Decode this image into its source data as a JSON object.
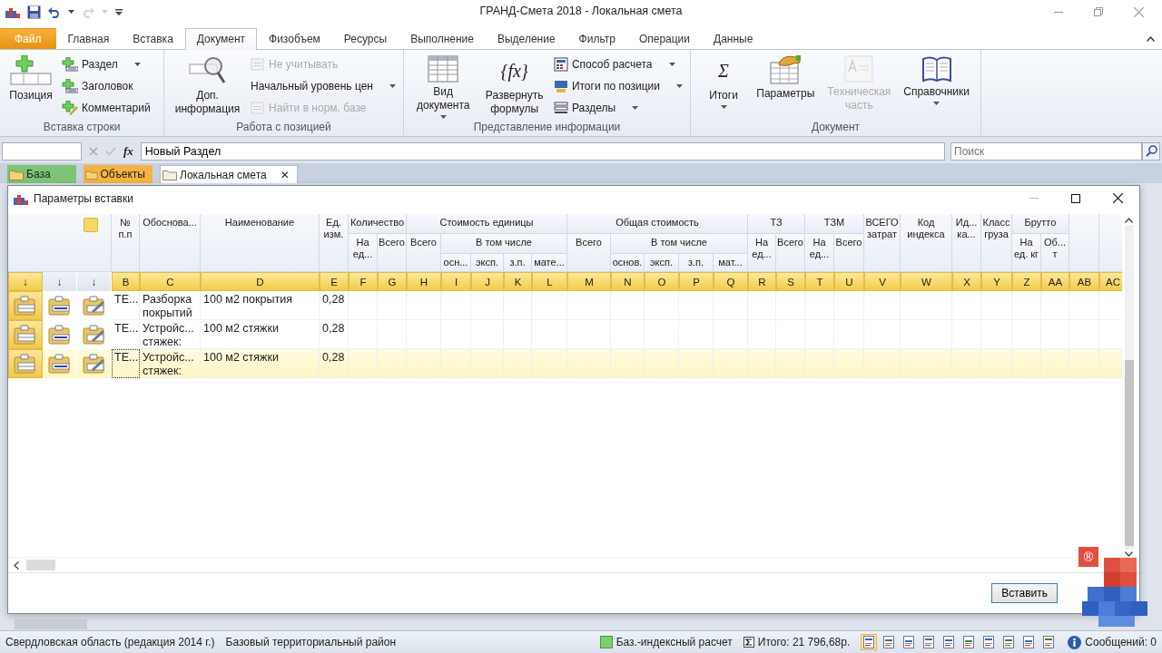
{
  "window": {
    "title": "ГРАНД-Смета 2018 - Локальная смета"
  },
  "ribbon_tabs": [
    {
      "label": "Файл",
      "kind": "file",
      "selected": false
    },
    {
      "label": "Главная",
      "kind": "tab",
      "selected": false
    },
    {
      "label": "Вставка",
      "kind": "tab",
      "selected": false
    },
    {
      "label": "Документ",
      "kind": "tab",
      "selected": true
    },
    {
      "label": "Физобъем",
      "kind": "tab",
      "selected": false
    },
    {
      "label": "Ресурсы",
      "kind": "tab",
      "selected": false
    },
    {
      "label": "Выполнение",
      "kind": "tab",
      "selected": false
    },
    {
      "label": "Выделение",
      "kind": "tab",
      "selected": false
    },
    {
      "label": "Фильтр",
      "kind": "tab",
      "selected": false
    },
    {
      "label": "Операции",
      "kind": "tab",
      "selected": false
    },
    {
      "label": "Данные",
      "kind": "tab",
      "selected": false
    }
  ],
  "ribbon_groups": [
    {
      "label": "Вставка строки",
      "items": [
        {
          "kind": "large",
          "label": "Позиция",
          "dropdown": false,
          "disabled": false
        },
        {
          "kind": "small",
          "label": "Раздел",
          "dropdown": true,
          "disabled": false
        },
        {
          "kind": "small",
          "label": "Заголовок",
          "dropdown": false,
          "disabled": false
        },
        {
          "kind": "small",
          "label": "Комментарий",
          "dropdown": false,
          "disabled": false
        }
      ]
    },
    {
      "label": "Работа с позицией",
      "items": [
        {
          "kind": "large",
          "label": "Доп. информация",
          "dropdown": false,
          "disabled": false
        },
        {
          "kind": "small",
          "label": "Не учитывать",
          "dropdown": false,
          "disabled": true
        },
        {
          "kind": "small",
          "label": "Начальный уровень цен",
          "dropdown": true,
          "disabled": false
        },
        {
          "kind": "small",
          "label": "Найти в норм. базе",
          "dropdown": false,
          "disabled": true
        }
      ]
    },
    {
      "label": "Представление информации",
      "items": [
        {
          "kind": "large",
          "label": "Вид документа",
          "dropdown": true,
          "disabled": false
        },
        {
          "kind": "large",
          "label": "Развернуть формулы",
          "glyph": "{fx}",
          "dropdown": false,
          "disabled": false
        },
        {
          "kind": "small",
          "label": "Способ расчета",
          "dropdown": true,
          "disabled": false
        },
        {
          "kind": "small",
          "label": "Итоги по позиции",
          "dropdown": true,
          "disabled": false
        },
        {
          "kind": "small",
          "label": "Разделы",
          "dropdown": true,
          "disabled": false
        }
      ]
    },
    {
      "label": "Документ",
      "items": [
        {
          "kind": "large",
          "label": "Итоги",
          "glyph": "Σ",
          "dropdown": true,
          "disabled": false
        },
        {
          "kind": "large",
          "label": "Параметры",
          "dropdown": false,
          "disabled": false
        },
        {
          "kind": "large",
          "label": "Техническая часть",
          "dropdown": false,
          "disabled": true
        },
        {
          "kind": "large",
          "label": "Справочники",
          "dropdown": true,
          "disabled": false
        }
      ]
    }
  ],
  "formula_bar": {
    "fx": "fx",
    "value": "Новый Раздел",
    "search_placeholder": "Поиск"
  },
  "doc_tabs": [
    {
      "label": "База",
      "color": "#7cc576",
      "selected": false
    },
    {
      "label": "Объекты",
      "color": "#f5b342",
      "selected": false
    },
    {
      "label": "Локальная смета",
      "color": "#ffffff",
      "close": "✕",
      "selected": true
    }
  ],
  "dialog": {
    "title": "Параметры вставки",
    "button": "Вставить"
  },
  "table": {
    "icon_columns": [
      {
        "arrow": "↓",
        "selected": true
      },
      {
        "arrow": "↓",
        "selected": false
      },
      {
        "arrow": "↓",
        "selected": false
      }
    ],
    "columns": [
      {
        "label": "№ п.п",
        "letter": "B"
      },
      {
        "label": "Обоснова...",
        "letter": "C"
      },
      {
        "label": "Наименование",
        "letter": "D"
      },
      {
        "label": "Ед. изм.",
        "letter": "E"
      },
      {
        "label": "Количество",
        "children": [
          {
            "label": "На ед...",
            "letter": "F"
          },
          {
            "label": "Всего",
            "letter": "G"
          }
        ]
      },
      {
        "label": "Стоимость единицы",
        "children": [
          {
            "label": "Всего",
            "letter": "H"
          },
          {
            "label": "В том числе",
            "children": [
              {
                "label": "осн...",
                "letter": "I"
              },
              {
                "label": "эксп.",
                "letter": "J"
              },
              {
                "label": "з.п.",
                "letter": "K"
              },
              {
                "label": "мате...",
                "letter": "L"
              }
            ]
          }
        ]
      },
      {
        "label": "Общая стоимость",
        "children": [
          {
            "label": "Всего",
            "letter": "M"
          },
          {
            "label": "В том числе",
            "children": [
              {
                "label": "основ.",
                "letter": "N"
              },
              {
                "label": "эксп.",
                "letter": "O"
              },
              {
                "label": "з.п.",
                "letter": "P"
              },
              {
                "label": "мат...",
                "letter": "Q"
              }
            ]
          }
        ]
      },
      {
        "label": "ТЗ",
        "children": [
          {
            "label": "На ед...",
            "letter": "R"
          },
          {
            "label": "Всего",
            "letter": "S"
          }
        ]
      },
      {
        "label": "ТЗМ",
        "children": [
          {
            "label": "На ед...",
            "letter": "T"
          },
          {
            "label": "Всего",
            "letter": "U"
          }
        ]
      },
      {
        "label": "ВСЕГО затрат",
        "letter": "V"
      },
      {
        "label": "Код индекса",
        "letter": "W"
      },
      {
        "label": "Ид... ка...",
        "letter": "X"
      },
      {
        "label": "Класс груза",
        "letter": "Y"
      },
      {
        "label": "Брутто",
        "children": [
          {
            "label": "На ед. кг",
            "letter": "Z"
          },
          {
            "label": "Об... т",
            "letter": "AA"
          }
        ]
      },
      {
        "letter": "AB"
      },
      {
        "letter": "AC"
      }
    ],
    "rows": [
      {
        "selected": false,
        "cells": [
          "ТЕ...",
          "Разборка покрытий",
          "100 м2 покрытия",
          "0,28"
        ]
      },
      {
        "selected": false,
        "cells": [
          "ТЕ...",
          "Устройс... стяжек:",
          "100 м2 стяжки",
          "0,28"
        ]
      },
      {
        "selected": true,
        "cells": [
          "ТЕ...",
          "Устройс... стяжек:",
          "100 м2 стяжки",
          "0,28"
        ]
      }
    ]
  },
  "logo": {
    "mark": "®"
  },
  "status_bar": {
    "region": "Свердловская область (редакция 2014 г.)",
    "district": "Базовый территориальный район",
    "mode": "Баз.-индексный расчет",
    "total": "Итого: 21 796,68р.",
    "view_buttons": [
      {
        "selected": true
      },
      {
        "selected": false
      },
      {
        "selected": false
      },
      {
        "selected": false
      },
      {
        "selected": false
      },
      {
        "selected": false
      },
      {
        "selected": false
      },
      {
        "selected": false
      },
      {
        "selected": false
      },
      {
        "selected": false
      }
    ],
    "messages": "Сообщений: 0"
  }
}
